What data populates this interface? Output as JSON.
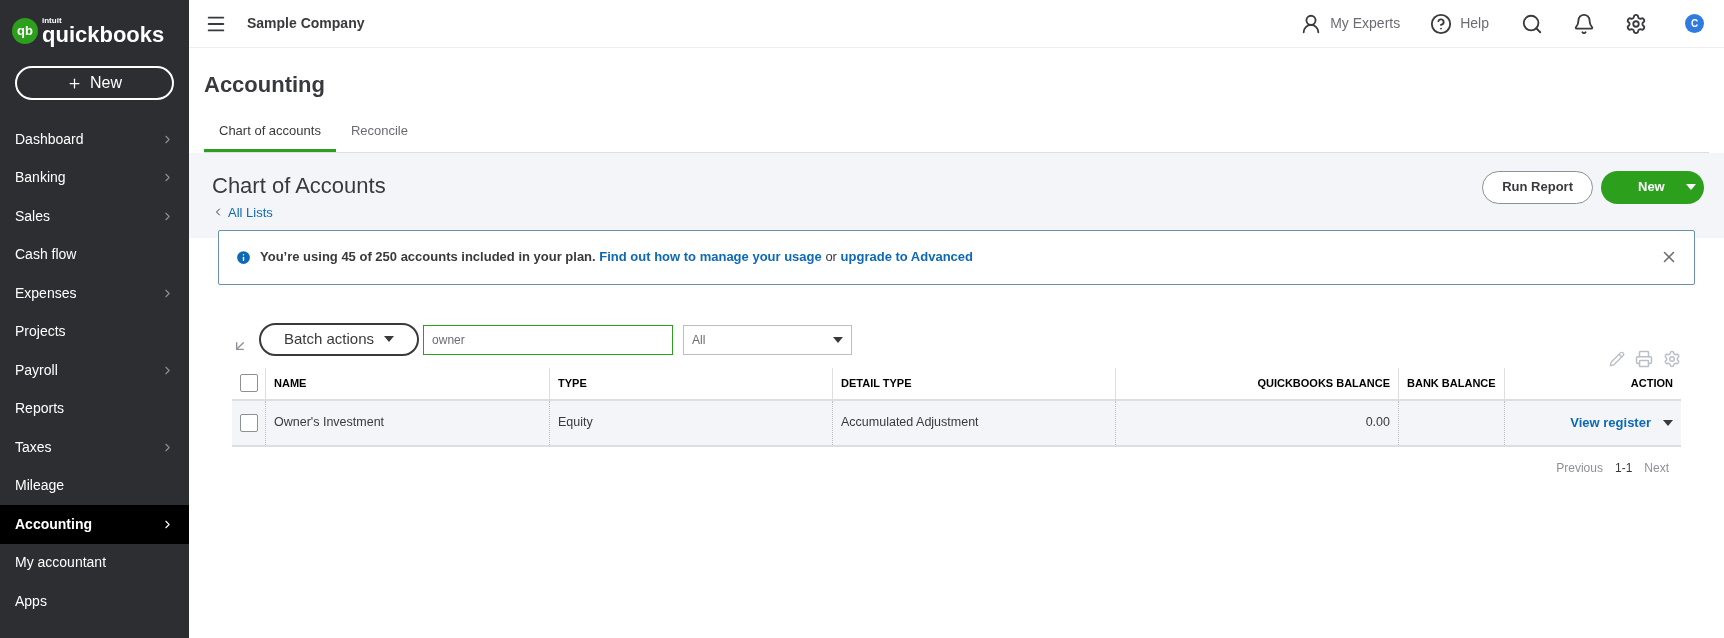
{
  "logo": {
    "badge": "qb",
    "brand": "intuit",
    "name": "quickbooks"
  },
  "sidebar": {
    "new_button": "New",
    "items": [
      {
        "label": "Dashboard",
        "has_arrow": true,
        "selected": false
      },
      {
        "label": "Banking",
        "has_arrow": true,
        "selected": false
      },
      {
        "label": "Sales",
        "has_arrow": true,
        "selected": false
      },
      {
        "label": "Cash flow",
        "has_arrow": false,
        "selected": false
      },
      {
        "label": "Expenses",
        "has_arrow": true,
        "selected": false
      },
      {
        "label": "Projects",
        "has_arrow": false,
        "selected": false
      },
      {
        "label": "Payroll",
        "has_arrow": true,
        "selected": false
      },
      {
        "label": "Reports",
        "has_arrow": false,
        "selected": false
      },
      {
        "label": "Taxes",
        "has_arrow": true,
        "selected": false
      },
      {
        "label": "Mileage",
        "has_arrow": false,
        "selected": false
      },
      {
        "label": "Accounting",
        "has_arrow": true,
        "selected": true
      },
      {
        "label": "My accountant",
        "has_arrow": false,
        "selected": false
      },
      {
        "label": "Apps",
        "has_arrow": false,
        "selected": false
      }
    ]
  },
  "top_bar": {
    "company": "Sample Company",
    "my_experts": "My Experts",
    "help": "Help",
    "avatar": "C"
  },
  "page_title": "Accounting",
  "tabs": [
    {
      "label": "Chart of accounts",
      "selected": true
    },
    {
      "label": "Reconcile",
      "selected": false
    }
  ],
  "header": {
    "title": "Chart of Accounts",
    "back_link": "All Lists",
    "run_report": "Run Report",
    "new": "New"
  },
  "banner": {
    "text": "You’re using 45 of 250 accounts included in your plan.",
    "link1": "Find out how to manage your usage",
    "joiner": "or",
    "link2": "upgrade to Advanced"
  },
  "toolbar": {
    "batch_actions": "Batch actions",
    "search_value": "owner",
    "filter": "All"
  },
  "table": {
    "all_checked": false,
    "columns": [
      "NAME",
      "TYPE",
      "DETAIL TYPE",
      "QUICKBOOKS BALANCE",
      "BANK BALANCE",
      "ACTION"
    ],
    "rows": [
      {
        "checked": false,
        "cells": [
          "Owner's Investment",
          "Equity",
          "Accumulated Adjustment",
          "0.00",
          ""
        ],
        "action": "View register"
      }
    ]
  },
  "pagination": {
    "previous": "Previous",
    "range": "1-1",
    "next": "Next"
  }
}
